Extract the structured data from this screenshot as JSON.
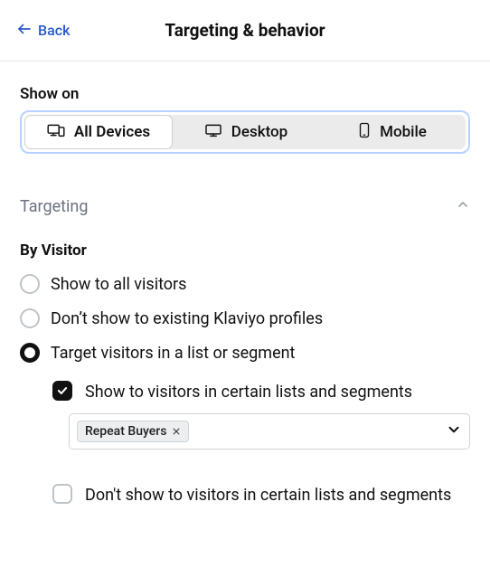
{
  "header": {
    "back_label": "Back",
    "title": "Targeting & behavior"
  },
  "show_on": {
    "label": "Show on",
    "options": [
      {
        "label": "All Devices",
        "icon": "devices-icon",
        "selected": true
      },
      {
        "label": "Desktop",
        "icon": "desktop-icon",
        "selected": false
      },
      {
        "label": "Mobile",
        "icon": "mobile-icon",
        "selected": false
      }
    ]
  },
  "targeting": {
    "section_title": "Targeting",
    "expanded": true,
    "by_visitor_heading": "By Visitor",
    "options": [
      {
        "label": "Show to all visitors",
        "selected": false
      },
      {
        "label": "Don’t show to existing Klaviyo profiles",
        "selected": false
      },
      {
        "label": "Target visitors in a list or segment",
        "selected": true
      }
    ],
    "list_segment": {
      "include_label": "Show to visitors in certain lists and segments",
      "include_checked": true,
      "include_tags": [
        "Repeat Buyers"
      ],
      "exclude_label": "Don't show to visitors in certain lists and segments",
      "exclude_checked": false
    }
  }
}
